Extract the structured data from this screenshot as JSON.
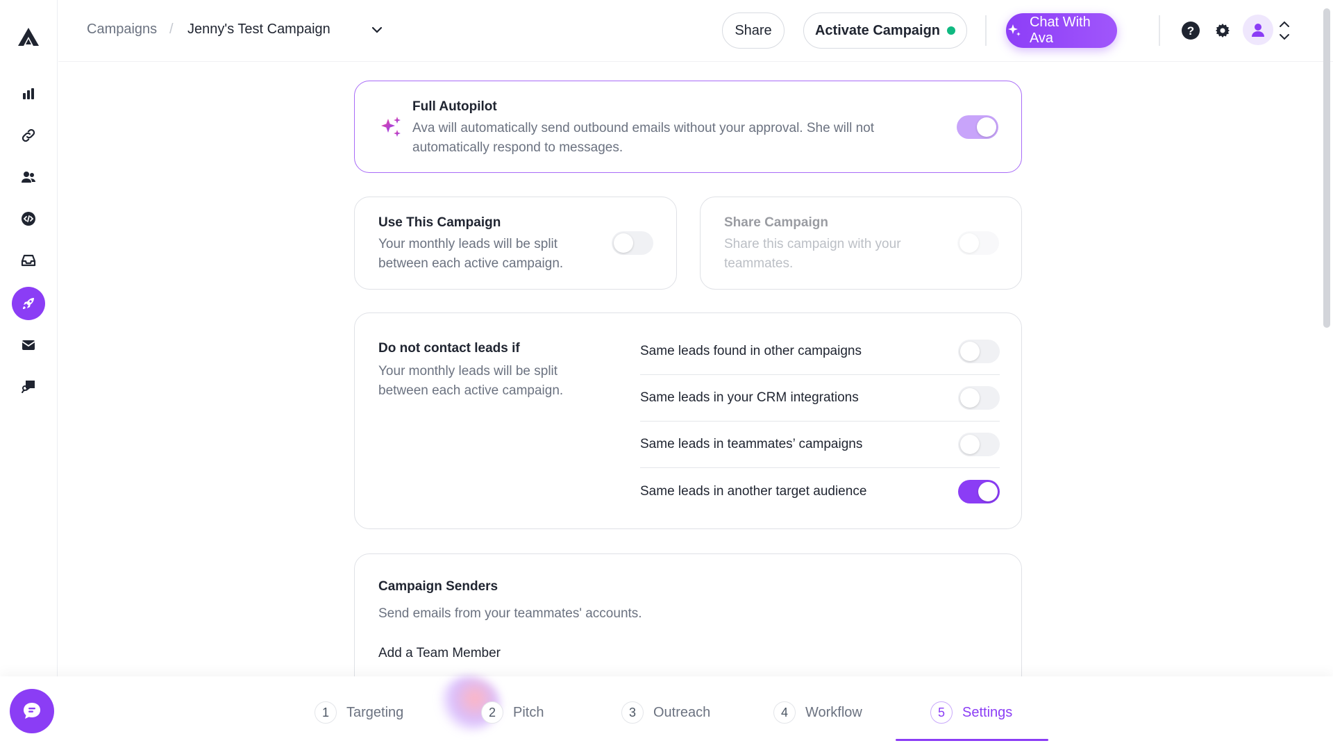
{
  "header": {
    "breadcrumb_root": "Campaigns",
    "breadcrumb_separator": "/",
    "breadcrumb_current": "Jenny's Test Campaign",
    "share_label": "Share",
    "activate_label": "Activate Campaign",
    "activate_status_color": "#10b981",
    "chat_label": "Chat With Ava"
  },
  "sidebar": {
    "items": [
      {
        "icon": "bar-chart-icon"
      },
      {
        "icon": "link-icon"
      },
      {
        "icon": "users-icon"
      },
      {
        "icon": "code-icon"
      },
      {
        "icon": "inbox-icon"
      },
      {
        "icon": "rocket-icon",
        "active": true
      },
      {
        "icon": "mail-icon"
      },
      {
        "icon": "chat-help-icon"
      }
    ]
  },
  "autopilot": {
    "title": "Full Autopilot",
    "description": "Ava will automatically send outbound emails without your approval. She will not automatically respond to messages.",
    "enabled": true
  },
  "use_campaign": {
    "title": "Use This Campaign",
    "description": "Your monthly leads will be split between each active campaign.",
    "enabled": false
  },
  "share_campaign": {
    "title": "Share Campaign",
    "description": "Share this campaign with your teammates.",
    "enabled": false
  },
  "do_not_contact": {
    "title": "Do not contact leads if",
    "description": "Your monthly leads will be split between each active campaign.",
    "options": [
      {
        "label": "Same leads found in other campaigns",
        "enabled": false
      },
      {
        "label": "Same leads in your CRM integrations",
        "enabled": false
      },
      {
        "label": "Same leads in teammates’ campaigns",
        "enabled": false
      },
      {
        "label": "Same leads in another target audience",
        "enabled": true
      }
    ]
  },
  "senders": {
    "title": "Campaign Senders",
    "description": "Send emails from your teammates' accounts.",
    "add_member": "Add a Team Member"
  },
  "steps": [
    {
      "num": "1",
      "label": "Targeting"
    },
    {
      "num": "2",
      "label": "Pitch"
    },
    {
      "num": "3",
      "label": "Outreach"
    },
    {
      "num": "4",
      "label": "Workflow"
    },
    {
      "num": "5",
      "label": "Settings",
      "active": true
    }
  ],
  "colors": {
    "accent": "#8b3df5",
    "accent_soft": "#c8a4fa",
    "text": "#1f2430",
    "muted": "#6b7280"
  }
}
